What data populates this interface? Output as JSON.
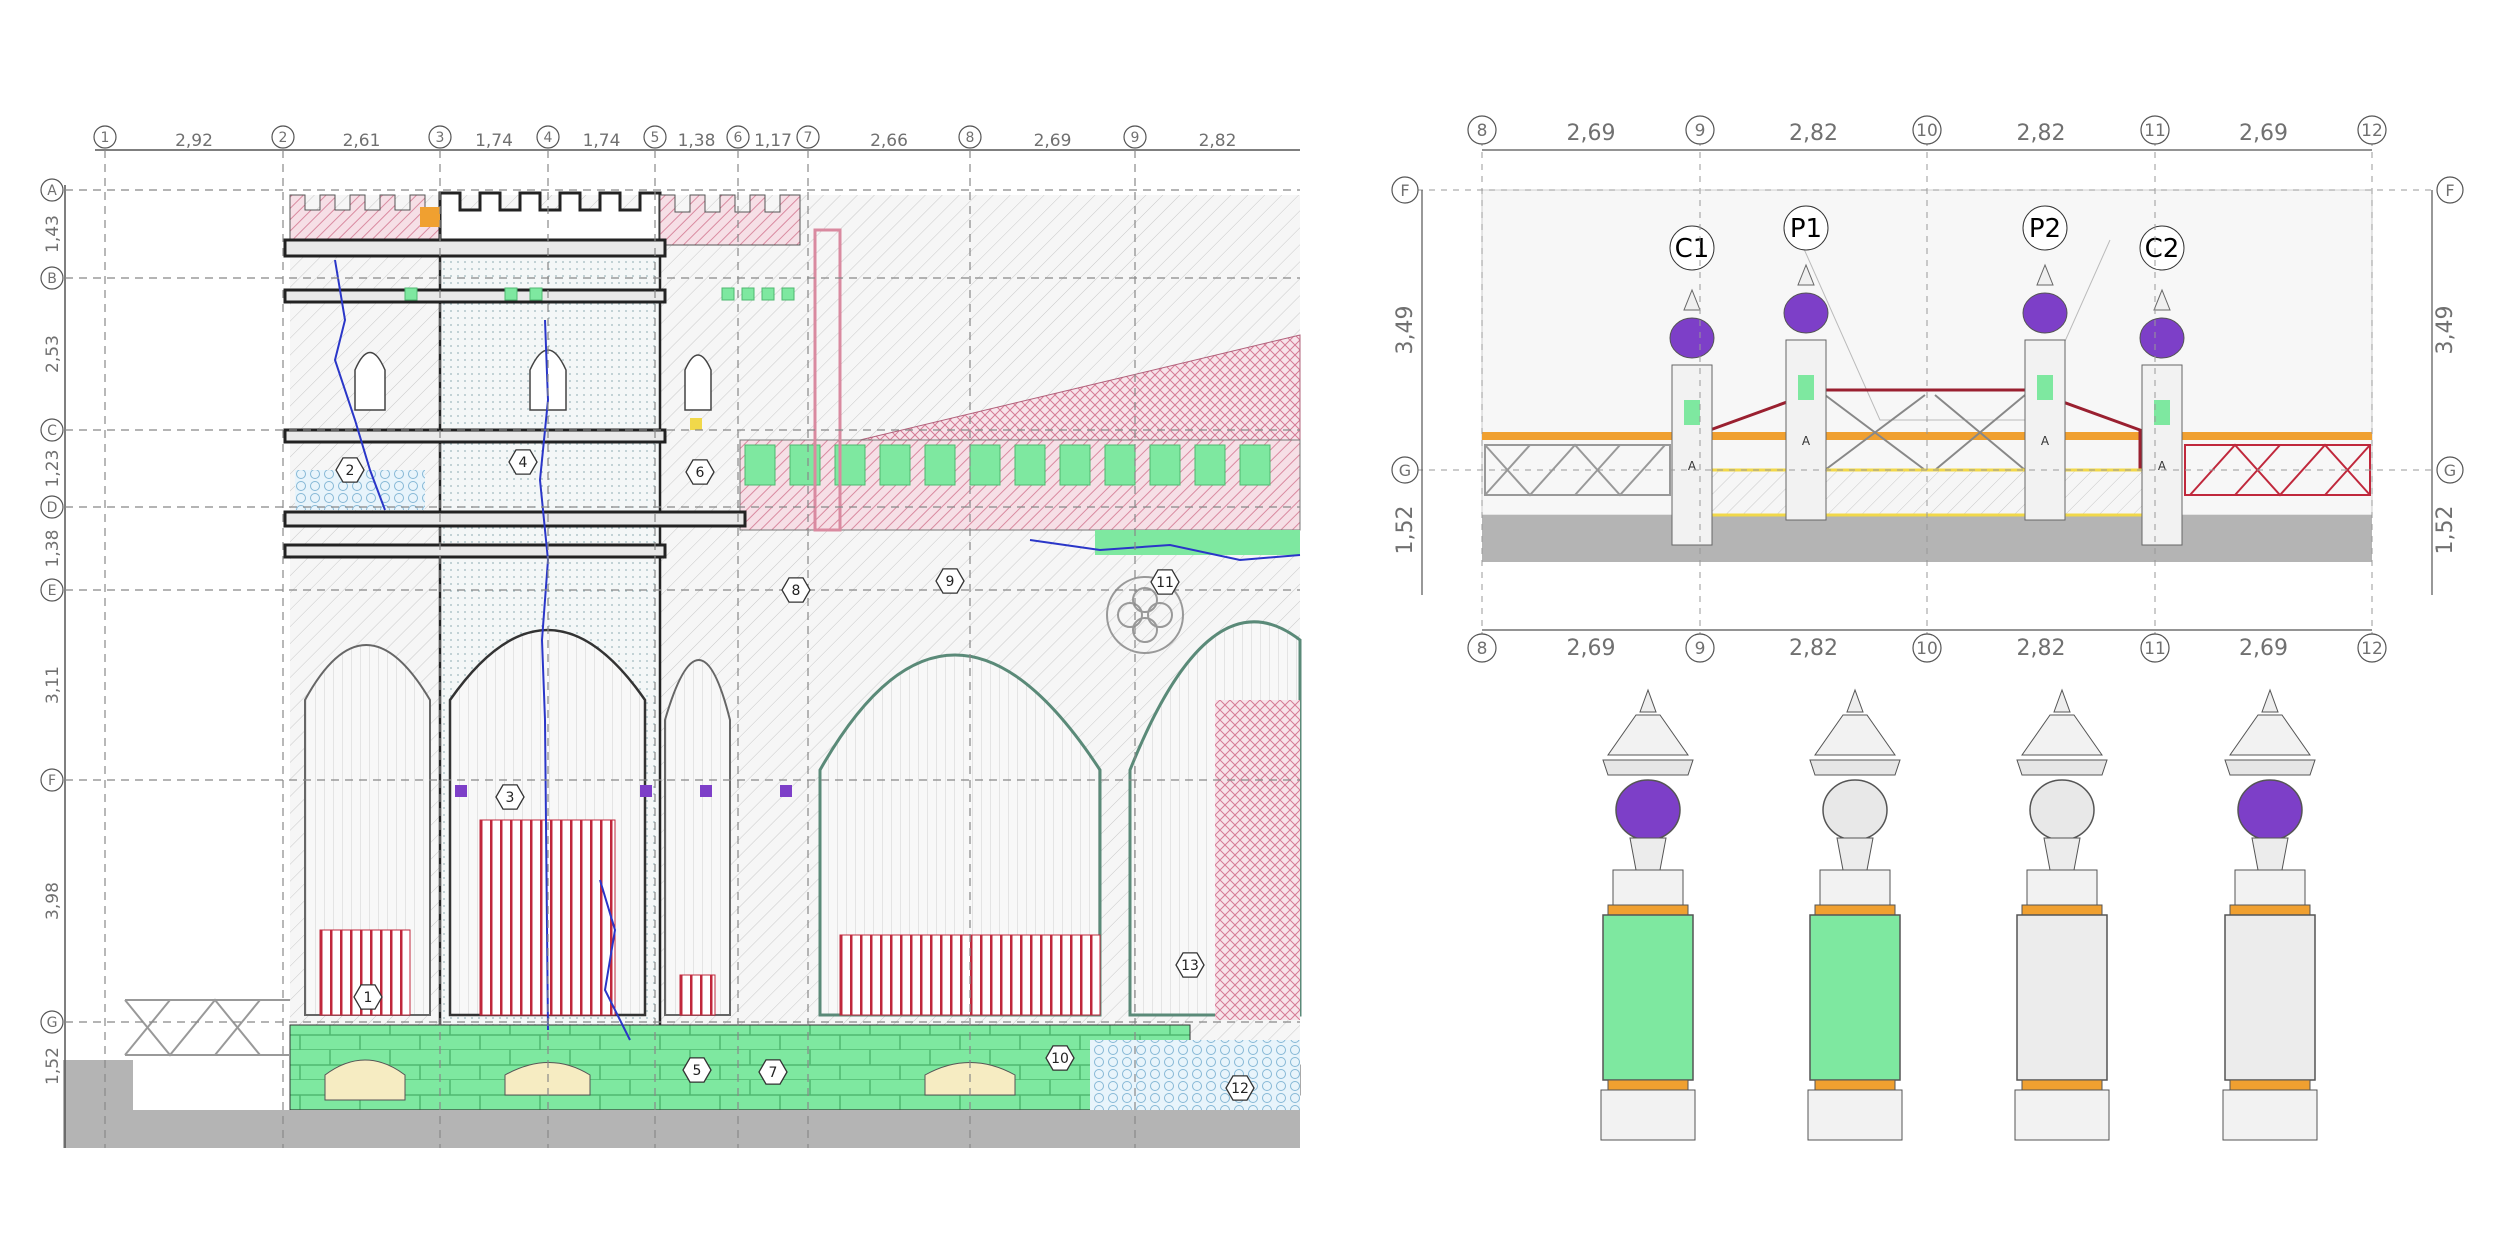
{
  "colors": {
    "grid": "#8a8a8a",
    "ground": "#b4b4b4",
    "stone": "#f2f2f2",
    "line": "#5a5a5a",
    "green": "#7ee8a0",
    "pink": "#d98aa0",
    "red": "#c0283c",
    "blue": "#2a36c8",
    "purple": "#7d3fc8",
    "yellow": "#f1d84a",
    "orange": "#f0a030",
    "rail": "#9a2030"
  },
  "elevation": {
    "columns": [
      {
        "id": "1",
        "dim": "2,92"
      },
      {
        "id": "2",
        "dim": "2,61"
      },
      {
        "id": "3",
        "dim": "1,74"
      },
      {
        "id": "4",
        "dim": "1,74"
      },
      {
        "id": "5",
        "dim": "1,38"
      },
      {
        "id": "6",
        "dim": "1,17"
      },
      {
        "id": "7",
        "dim": "2,66"
      },
      {
        "id": "8",
        "dim": "2,69"
      },
      {
        "id": "9",
        "dim": "2,82"
      }
    ],
    "rows": [
      {
        "id": "A",
        "dim": "1,43"
      },
      {
        "id": "B",
        "dim": "2,53"
      },
      {
        "id": "C",
        "dim": "1,23"
      },
      {
        "id": "D",
        "dim": "1,38"
      },
      {
        "id": "E",
        "dim": "3,11"
      },
      {
        "id": "F",
        "dim": "3,98"
      },
      {
        "id": "G",
        "dim": "1,52"
      }
    ],
    "tags": [
      "1",
      "2",
      "3",
      "4",
      "5",
      "6",
      "7",
      "8",
      "9",
      "10",
      "11",
      "12",
      "13"
    ]
  },
  "detail": {
    "cols_top": [
      "8",
      "9",
      "10",
      "11",
      "12"
    ],
    "dims": [
      "2,69",
      "2,82",
      "2,82",
      "2,69"
    ],
    "rows": [
      "F",
      "G"
    ],
    "vdims": [
      "3,49",
      "1,52"
    ],
    "posts": [
      "C1",
      "P1",
      "P2",
      "C2"
    ],
    "marker": "A"
  }
}
